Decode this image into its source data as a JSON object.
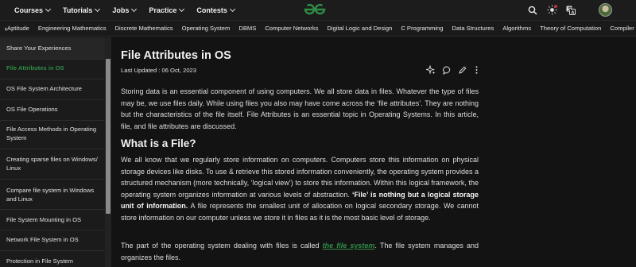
{
  "nav": {
    "menu": [
      {
        "label": "Courses"
      },
      {
        "label": "Tutorials"
      },
      {
        "label": "Jobs"
      },
      {
        "label": "Practice"
      },
      {
        "label": "Contests"
      }
    ],
    "logo": "GfG",
    "icons": [
      "search-icon",
      "theme-toggle-icon",
      "translate-icon",
      "avatar"
    ]
  },
  "subjects": {
    "items": [
      "Aptitude",
      "Engineering Mathematics",
      "Discrete Mathematics",
      "Operating System",
      "DBMS",
      "Computer Networks",
      "Digital Logic and Design",
      "C Programming",
      "Data Structures",
      "Algorithms",
      "Theory of Computation",
      "Compiler Desi"
    ]
  },
  "sidebar": {
    "items": [
      "Share Your Experiences",
      "File Attributes in OS",
      "OS File System Architecture",
      "OS File Operations",
      "File Access Methods in Operating System",
      "Creating sparse files on Windows/ Linux",
      "Compare file system in Windows and Linux",
      "File System Mounting in OS",
      "Network File System in OS",
      "Protection in File System"
    ],
    "active_index": 1
  },
  "article": {
    "title": "File Attributes in OS",
    "updated": "Last Updated : 06 Oct, 2023",
    "intro": "Storing data is an essential component of using computers. We all store data in files. Whatever the type of files may be, we use files daily. While using files you also may have come across the ‘file attributes’. They are nothing but the characteristics of the file itself. File Attributes is an essential topic in Operating Systems. In this article, file, and file attributes are discussed.",
    "h2": "What is a File?",
    "p2_a": "We all know that we regularly store information on computers. Computers store this information on physical storage devices like disks. To use & retrieve this stored information conveniently, the operating system provides a structured mechanism (more technically, ‘logical view’) to store this information. Within this logical framework, the operating system organizes information at various levels of abstraction. ",
    "p2_bold": "‘File’ is nothing but a logical storage unit of information.",
    "p2_b": " A file represents the smallest unit of allocation on logical secondary storage. We cannot store information on our computer unless we store it in files as it is the most basic level of storage.",
    "p3_a": "The part of the operating system dealing with files is called ",
    "p3_link": "the file system",
    "p3_b": ". The file system manages and organizes the files."
  },
  "colors": {
    "accent": "#2f8d46",
    "background": "#131313"
  }
}
